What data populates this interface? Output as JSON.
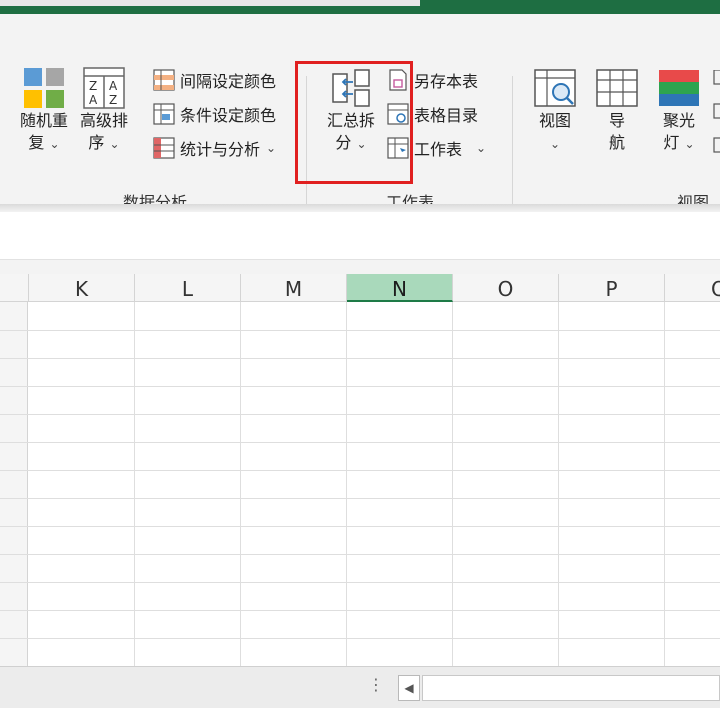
{
  "ribbon": {
    "random_repeat_label": "随机重复",
    "random_repeat_line1": "随机重",
    "random_repeat_line2": "复",
    "advanced_sort_line1": "高级排",
    "advanced_sort_line2": "序",
    "interval_color_label": "间隔设定颜色",
    "condition_color_label": "条件设定颜色",
    "stats_analysis_label": "统计与分析",
    "summary_split_line1": "汇总拆",
    "summary_split_line2": "分",
    "save_sheet_label": "另存本表",
    "table_directory_label": "表格目录",
    "worksheet_label": "工作表",
    "view_label": "视图",
    "navigation_line1": "导",
    "navigation_line2": "航",
    "spotlight_line1": "聚光",
    "spotlight_line2": "灯",
    "caret": "⌄",
    "group_data_analysis": "数据分析",
    "group_worksheet": "工作表",
    "group_view": "视图"
  },
  "grid": {
    "columns": [
      "K",
      "L",
      "M",
      "N",
      "O",
      "P",
      "Q"
    ],
    "selected_column": "N"
  },
  "statusbar": {
    "dots": "⋮",
    "scroll_left_arrow": "◀"
  },
  "colors": {
    "excel_green": "#1e6e42",
    "selected_header": "#a9d9bb",
    "highlight_box": "#e02020"
  }
}
